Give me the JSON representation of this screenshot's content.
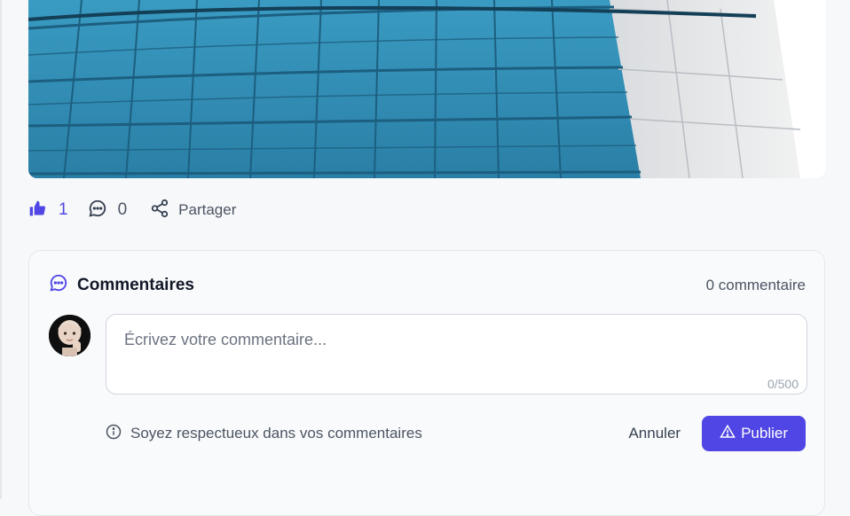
{
  "post": {
    "image_alt": "Building with blue glass facade"
  },
  "actions": {
    "likes": "1",
    "comments": "0",
    "share_label": "Partager"
  },
  "comments_section": {
    "title": "Commentaires",
    "count_label": "0 commentaire",
    "textarea_placeholder": "Écrivez votre commentaire...",
    "textarea_value": "",
    "char_counter": "0/500",
    "hint": "Soyez respectueux dans vos commentaires",
    "cancel_label": "Annuler",
    "publish_label": "Publier"
  },
  "colors": {
    "accent": "#4f46e5",
    "text_muted": "#4b5563",
    "border": "#e5e7eb"
  },
  "icons": {
    "like": "thumbs-up-icon",
    "comment": "speech-bubble-icon",
    "share": "share-icon",
    "section": "chat-bubble-icon",
    "info": "info-icon",
    "publish": "warning-triangle-icon"
  }
}
